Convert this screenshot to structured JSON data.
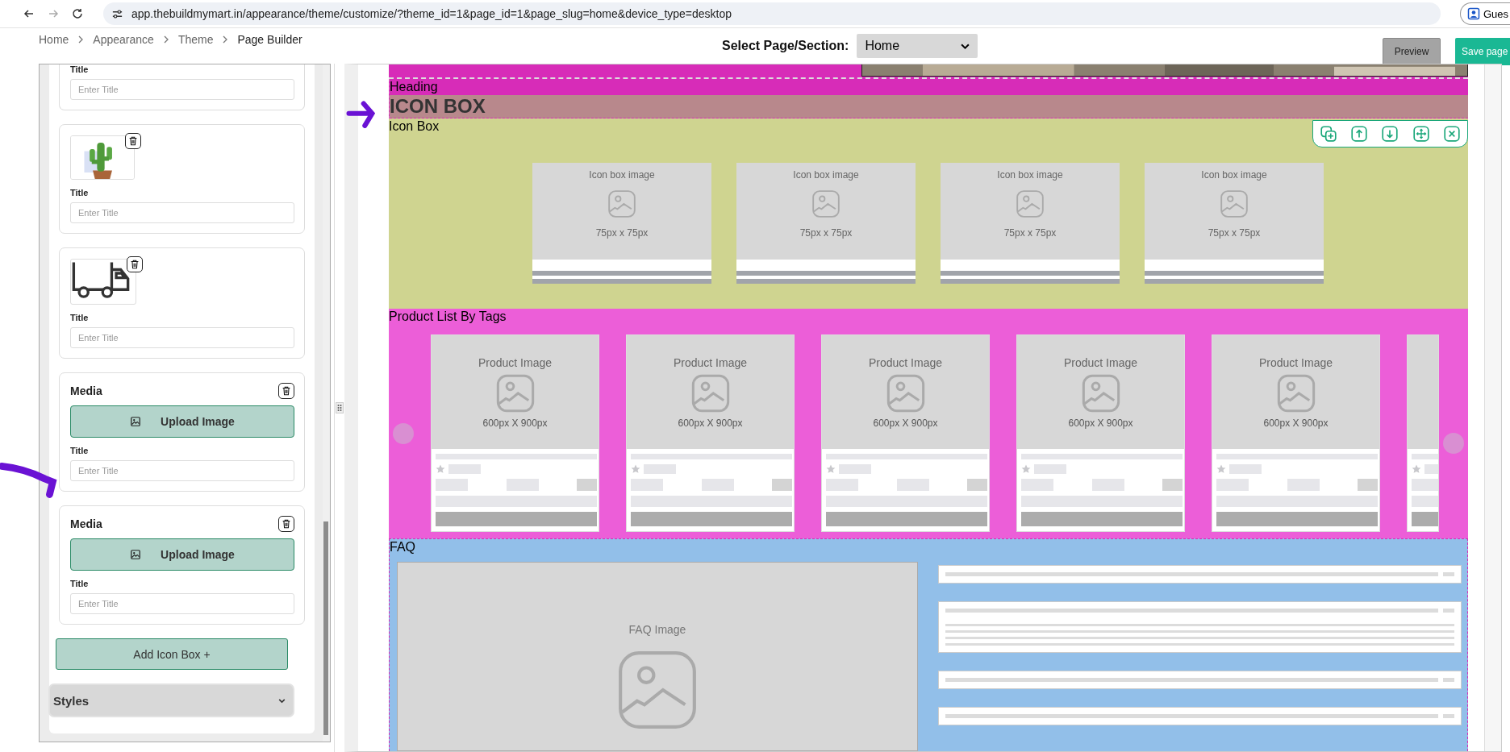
{
  "browser": {
    "url": "app.thebuildmymart.in/appearance/theme/customize/?theme_id=1&page_id=1&page_slug=home&device_type=desktop",
    "profile_label": "Gues"
  },
  "breadcrumb": [
    "Home",
    "Appearance",
    "Theme",
    "Page Builder"
  ],
  "page_select": {
    "label": "Select Page/Section:",
    "value": "Home"
  },
  "buttons": {
    "preview": "Preview",
    "save": "Save page"
  },
  "sidebar": {
    "cards": [
      {
        "kind": "field",
        "field_label": "Title",
        "placeholder": "Enter Title"
      },
      {
        "kind": "picture",
        "field_label": "Title",
        "placeholder": "Enter Title"
      },
      {
        "kind": "truck",
        "field_label": "Title",
        "placeholder": "Enter Title"
      },
      {
        "kind": "media",
        "heading": "Media",
        "upload": "Upload Image",
        "field_label": "Title",
        "placeholder": "Enter Title"
      },
      {
        "kind": "media",
        "heading": "Media",
        "upload": "Upload Image",
        "field_label": "Title",
        "placeholder": "Enter Title"
      }
    ],
    "add_button": "Add Icon Box +",
    "styles": {
      "label": "Styles",
      "expanded": false
    }
  },
  "canvas": {
    "heading_section": {
      "label": "Heading",
      "text": "ICON BOX"
    },
    "icon_box_section": {
      "label": "Icon Box",
      "items": [
        {
          "label": "Icon box image",
          "size": "75px x 75px"
        },
        {
          "label": "Icon box image",
          "size": "75px x 75px"
        },
        {
          "label": "Icon box image",
          "size": "75px x 75px"
        },
        {
          "label": "Icon box image",
          "size": "75px x 75px"
        }
      ]
    },
    "product_section": {
      "label": "Product List By Tags",
      "items": [
        {
          "kind": "card",
          "label": "Product Image",
          "size": "600px X 900px"
        },
        {
          "kind": "card",
          "label": "Product Image",
          "size": "600px X 900px"
        },
        {
          "kind": "card",
          "label": "Product Image",
          "size": "600px X 900px"
        },
        {
          "kind": "card",
          "label": "Product Image",
          "size": "600px X 900px"
        },
        {
          "kind": "card",
          "label": "Product Image",
          "size": "600px X 900px"
        },
        {
          "kind": "partial"
        }
      ]
    },
    "faq_section": {
      "label": "FAQ",
      "image_label": "FAQ Image",
      "rows": [
        {
          "expanded": false
        },
        {
          "expanded": true
        },
        {
          "expanded": false
        },
        {
          "expanded": false
        }
      ]
    }
  }
}
